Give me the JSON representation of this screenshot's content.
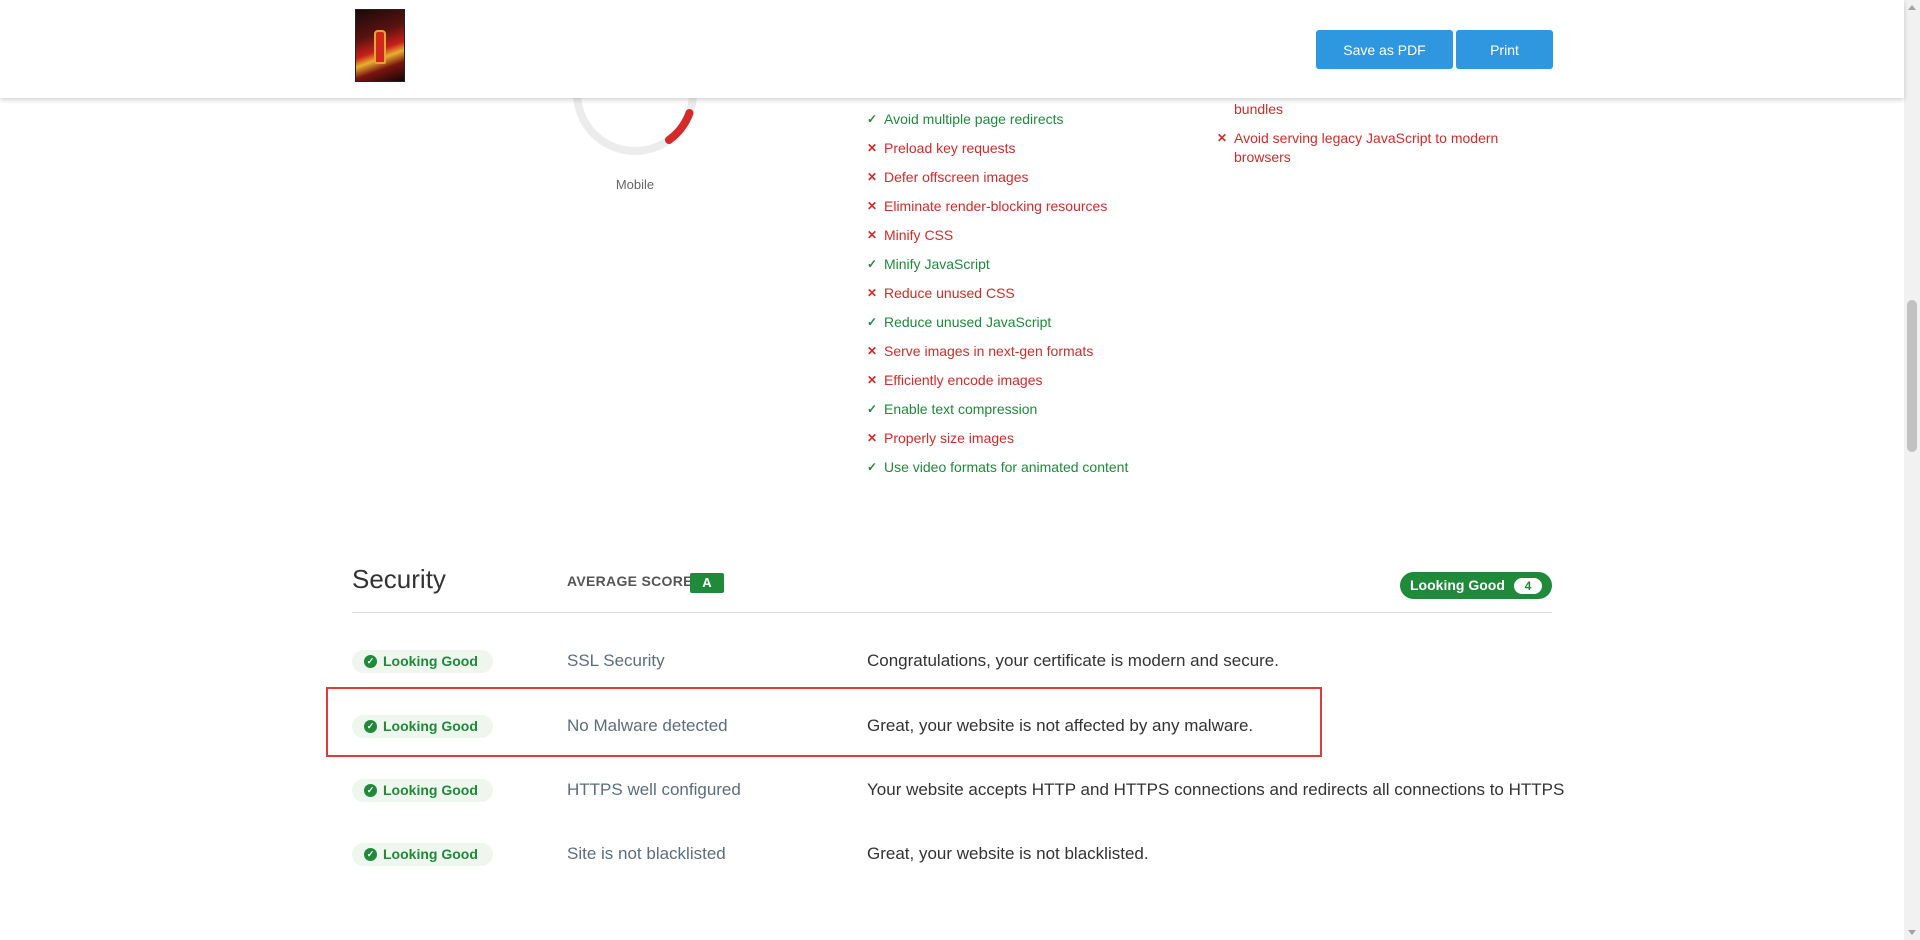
{
  "header": {
    "save_pdf_label": "Save as PDF",
    "print_label": "Print",
    "thumbnail_icon": "site-thumbnail"
  },
  "gauge": {
    "label": "Mobile",
    "colors": {
      "track": "#e8e8e8",
      "value": "#d42a2a"
    }
  },
  "audits_left": [
    {
      "text": "Avoid multiple page redirects",
      "status": "pass"
    },
    {
      "text": "Preload key requests",
      "status": "fail"
    },
    {
      "text": "Defer offscreen images",
      "status": "fail"
    },
    {
      "text": "Eliminate render-blocking resources",
      "status": "fail"
    },
    {
      "text": "Minify CSS",
      "status": "fail"
    },
    {
      "text": "Minify JavaScript",
      "status": "pass"
    },
    {
      "text": "Reduce unused CSS",
      "status": "fail"
    },
    {
      "text": "Reduce unused JavaScript",
      "status": "pass"
    },
    {
      "text": "Serve images in next-gen formats",
      "status": "fail"
    },
    {
      "text": "Efficiently encode images",
      "status": "fail"
    },
    {
      "text": "Enable text compression",
      "status": "pass"
    },
    {
      "text": "Properly size images",
      "status": "fail"
    },
    {
      "text": "Use video formats for animated content",
      "status": "pass"
    }
  ],
  "audits_right": [
    {
      "text": "bundles",
      "status": "fail",
      "continuation": true
    },
    {
      "text": "Avoid serving legacy JavaScript to modern browsers",
      "status": "fail"
    }
  ],
  "security": {
    "title": "Security",
    "average_label": "AVERAGE SCORE:",
    "average_score": "A",
    "summary_label": "Looking Good",
    "summary_count": "4",
    "rows": [
      {
        "status": "Looking Good",
        "name": "SSL Security",
        "description": "Congratulations, your certificate is modern and secure."
      },
      {
        "status": "Looking Good",
        "name": "No Malware detected",
        "description": "Great, your website is not affected by any malware."
      },
      {
        "status": "Looking Good",
        "name": "HTTPS well configured",
        "description": "Your website accepts HTTP and HTTPS connections and redirects all connections to HTTPS"
      },
      {
        "status": "Looking Good",
        "name": "Site is not blacklisted",
        "description": "Great, your website is not blacklisted."
      }
    ]
  },
  "colors": {
    "pass": "#1e8a3a",
    "fail": "#d42a2a",
    "button": "#2e97e0",
    "highlight": "#e03a3a"
  },
  "icons": {
    "pass": "check-icon",
    "fail": "cross-icon",
    "status": "check-circle-icon"
  }
}
